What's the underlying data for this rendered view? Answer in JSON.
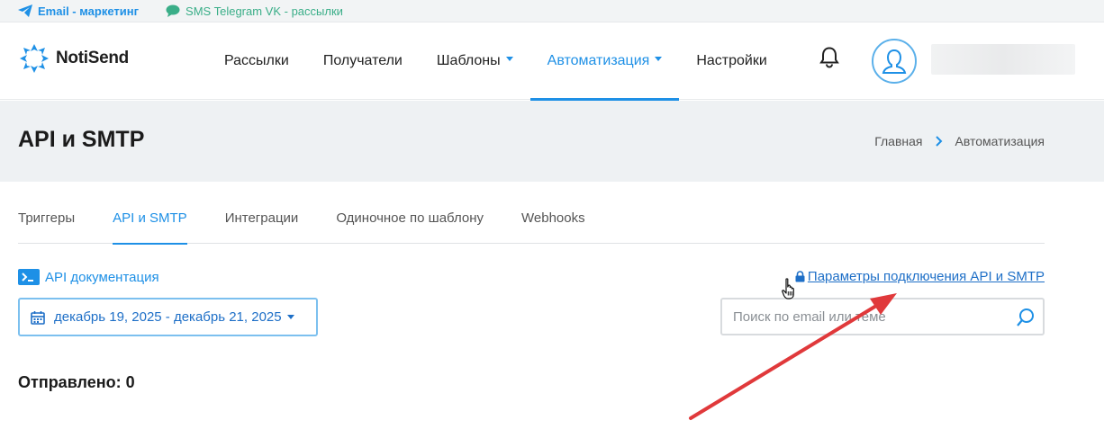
{
  "topbar": {
    "email_label": "Email - маркетинг",
    "sms_label": "SMS Telegram VK - рассылки"
  },
  "logo": {
    "text": "NotiSend"
  },
  "nav": {
    "items": [
      {
        "label": "Рассылки"
      },
      {
        "label": "Получатели"
      },
      {
        "label": "Шаблоны"
      },
      {
        "label": "Автоматизация"
      },
      {
        "label": "Настройки"
      }
    ]
  },
  "page": {
    "title": "API и SMTP",
    "breadcrumb": [
      "Главная",
      "Автоматизация"
    ]
  },
  "tabs": [
    {
      "label": "Триггеры"
    },
    {
      "label": "API и SMTP"
    },
    {
      "label": "Интеграции"
    },
    {
      "label": "Одиночное по шаблону"
    },
    {
      "label": "Webhooks"
    }
  ],
  "api_doc_label": "API документация",
  "connection_link": "Параметры подключения API и SMTP",
  "date_range": "декабрь 19, 2025 - декабрь 21, 2025",
  "search": {
    "placeholder": "Поиск по email или теме",
    "value": ""
  },
  "sent_label": "Отправлено: 0",
  "colors": {
    "accent": "#1e90e6",
    "sms": "#3aae88",
    "annotation_arrow": "#e0393b"
  },
  "icons": [
    "paper-plane-icon",
    "chat-bubble-icon",
    "bell-icon",
    "user-icon",
    "chevron-right-icon",
    "terminal-icon",
    "lock-icon",
    "calendar-icon",
    "search-icon",
    "hand-cursor-icon"
  ]
}
